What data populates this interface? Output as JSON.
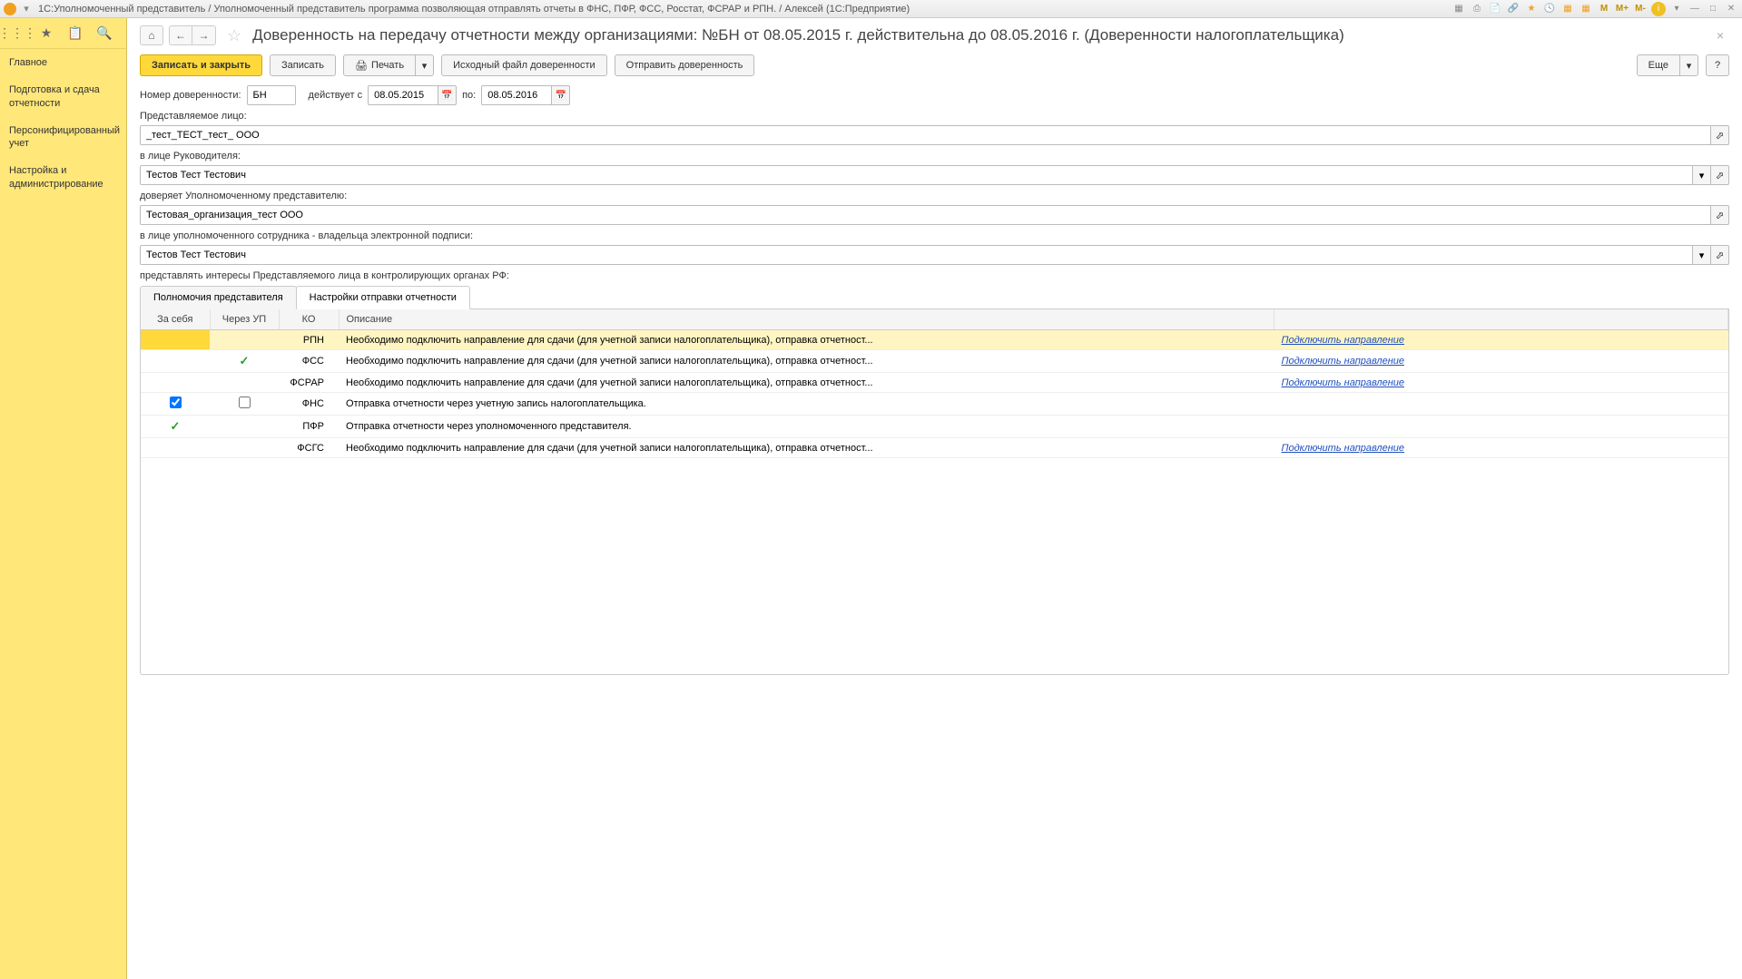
{
  "titlebar": {
    "text": "1С:Уполномоченный представитель / Уполномоченный представитель программа позволяющая отправлять отчеты в ФНС, ПФР, ФСС, Росстат, ФСРАР и РПН. / Алексей  (1С:Предприятие)",
    "tools": {
      "m": "M",
      "m_plus": "M+",
      "m_minus": "M-"
    }
  },
  "sidebar": {
    "items": [
      "Главное",
      "Подготовка и сдача отчетности",
      "Персонифицированный учет",
      "Настройка и администрирование"
    ]
  },
  "page": {
    "title": "Доверенность на передачу отчетности между организациями: №БН от 08.05.2015 г. действительна до 08.05.2016 г. (Доверенности налогоплательщика)"
  },
  "buttons": {
    "save_close": "Записать и закрыть",
    "save": "Записать",
    "print": "Печать",
    "source_file": "Исходный файл доверенности",
    "send": "Отправить доверенность",
    "more": "Еще",
    "help": "?"
  },
  "form": {
    "number_label": "Номер доверенности:",
    "number_value": "БН",
    "valid_from_label": "действует с",
    "date_from": "08.05.2015",
    "to_label": "по:",
    "date_to": "08.05.2016",
    "represented_label": "Представляемое лицо:",
    "represented_value": "_тест_ТЕСТ_тест_ ООО",
    "director_label": "в лице Руководителя:",
    "director_value": "Тестов Тест Тестович",
    "delegates_label": "доверяет Уполномоченному представителю:",
    "delegates_value": "Тестовая_организация_тест ООО",
    "employee_label": "в лице уполномоченного сотрудника  - владельца электронной подписи:",
    "employee_value": "Тестов Тест Тестович",
    "interests_label": "представлять интересы Представляемого лица в контролирующих органах РФ:"
  },
  "tabs": {
    "tab1": "Полномочия представителя",
    "tab2": "Настройки отправки отчетности"
  },
  "table": {
    "headers": {
      "self": "За себя",
      "via_up": "Через УП",
      "ko": "КО",
      "desc": "Описание"
    },
    "link_text": "Подключить направление",
    "rows": [
      {
        "self": "",
        "via_up": "",
        "ko": "РПН",
        "desc": "Необходимо подключить направление для сдачи (для учетной записи налогоплательщика), отправка отчетност...",
        "has_link": true,
        "highlight": true
      },
      {
        "self": "",
        "via_up": "check",
        "ko": "ФСС",
        "desc": "Необходимо подключить направление для сдачи (для учетной записи налогоплательщика), отправка отчетност...",
        "has_link": true
      },
      {
        "self": "",
        "via_up": "",
        "ko": "ФСРАР",
        "desc": "Необходимо подключить направление для сдачи (для учетной записи налогоплательщика), отправка отчетност...",
        "has_link": true
      },
      {
        "self": "checkbox_on",
        "via_up": "checkbox_off",
        "ko": "ФНС",
        "desc": "Отправка отчетности через учетную запись налогоплательщика.",
        "has_link": false
      },
      {
        "self": "check",
        "via_up": "",
        "ko": "ПФР",
        "desc": "Отправка отчетности через уполномоченного представителя.",
        "has_link": false
      },
      {
        "self": "",
        "via_up": "",
        "ko": "ФСГС",
        "desc": "Необходимо подключить направление для сдачи (для учетной записи налогоплательщика), отправка отчетност...",
        "has_link": true
      }
    ]
  }
}
